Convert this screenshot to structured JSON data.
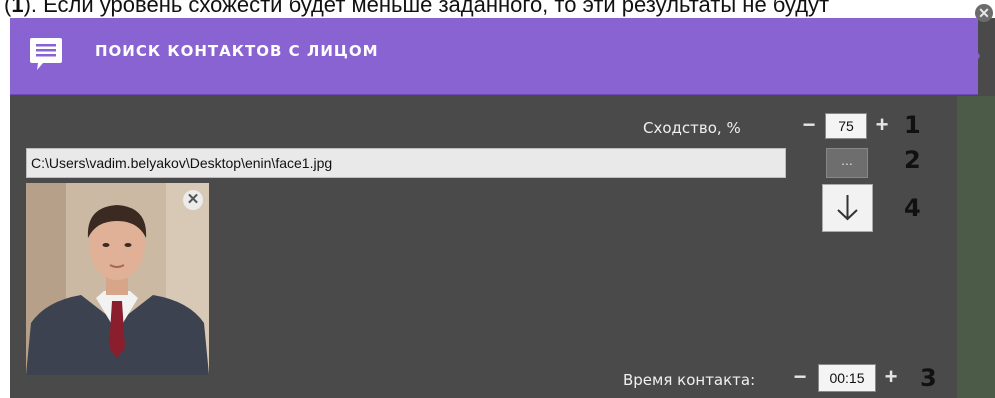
{
  "doc_text": {
    "prefix": "(",
    "bold": "1",
    "rest": "). Если уровень схожести будет меньше заданного, то эти результаты не будут"
  },
  "header": {
    "title": "ПОИСК КОНТАКТОВ С ЛИЦОМ",
    "icon": "message-list-icon",
    "color": "#8a63d2"
  },
  "similarity": {
    "label": "Сходство, %",
    "value": "75",
    "minus": "−",
    "plus": "+"
  },
  "file": {
    "path": "C:\\Users\\vadim.belyakov\\Desktop\\enin\\face1.jpg",
    "browse_label": "..."
  },
  "contact_time": {
    "label": "Время контакта:",
    "value": "00:15",
    "minus": "−",
    "plus": "+"
  },
  "callouts": [
    "1",
    "2",
    "3",
    "4"
  ],
  "corner_close": "✕",
  "photo_close": "✕"
}
